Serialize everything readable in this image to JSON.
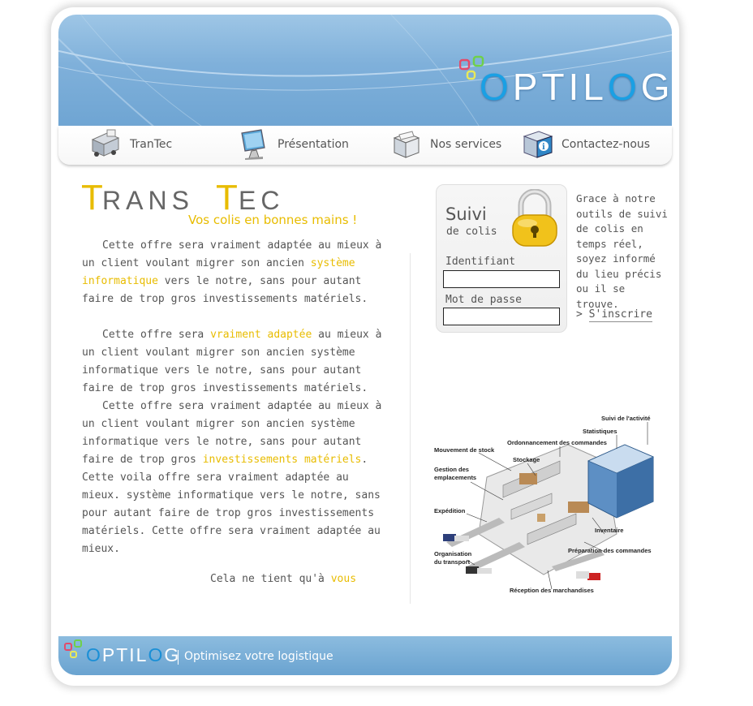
{
  "brand": {
    "logo_o": "O",
    "logo_rest": "PTIL",
    "logo_o2": "O",
    "logo_g": "G"
  },
  "nav": {
    "items": [
      {
        "label": "TranTec",
        "icon": "truck-box-icon"
      },
      {
        "label": "Présentation",
        "icon": "computer-monitor-icon"
      },
      {
        "label": "Nos services",
        "icon": "package-box-icon"
      },
      {
        "label": "Contactez-nous",
        "icon": "info-cube-icon"
      }
    ]
  },
  "hero": {
    "title": "TRANSTEC",
    "tagline": "Vos colis en bonnes mains !"
  },
  "content": {
    "p1": {
      "a": "Cette offre sera vraiment adaptée au mieux à un client voulant migrer son ancien ",
      "hl": "système informatique",
      "b": " vers le notre, sans pour autant faire de trop gros investissements matériels."
    },
    "p2": {
      "a": "Cette offre sera ",
      "hl": "vraiment adaptée",
      "b": " au mieux à un client voulant migrer son ancien système informatique vers le notre, sans pour autant faire de trop gros investissements matériels."
    },
    "p3": {
      "a": "Cette offre sera vraiment adaptée au mieux à un client voulant migrer son ancien système informatique vers le notre, sans pour autant faire de trop gros ",
      "hl": "investissements matériels",
      "b": ". Cette voila offre sera vraiment adaptée au mieux. système informatique vers le notre, sans pour autant faire de trop gros investissements matériels. Cette offre sera vraiment adaptée au mieux."
    },
    "contact_prefix": "Cela ne tient qu'à ",
    "contact_link": "vous"
  },
  "tracking": {
    "title": "Suivi",
    "subtitle": "de colis",
    "id_label": "Identifiant",
    "id_value": "",
    "pw_label": "Mot de passe",
    "pw_value": "",
    "description": "Grace à notre outils de suivi de colis en temps réel, soyez informé du lieu précis ou il se trouve.",
    "signup_prefix": ">",
    "signup_link": "S'inscrire"
  },
  "diagram": {
    "labels": {
      "suivi": "Suivi de l'activité",
      "stats": "Statistiques",
      "ordo": "Ordonnancement des commandes",
      "mouvement": "Mouvement de stock",
      "stockage": "Stockage",
      "gestion1": "Gestion des",
      "gestion2": "emplacements",
      "expedition": "Expédition",
      "inventaire": "Inventaire",
      "orga1": "Organisation",
      "orga2": "du transport",
      "prepa": "Préparation des commandes",
      "reception": "Réception des marchandises"
    }
  },
  "footer": {
    "slogan": "Optimisez votre logistique"
  },
  "colors": {
    "accent": "#e8bc00",
    "header_blue": "#7fb0da",
    "logo_blue": "#1aa0e4",
    "text": "#555555"
  }
}
